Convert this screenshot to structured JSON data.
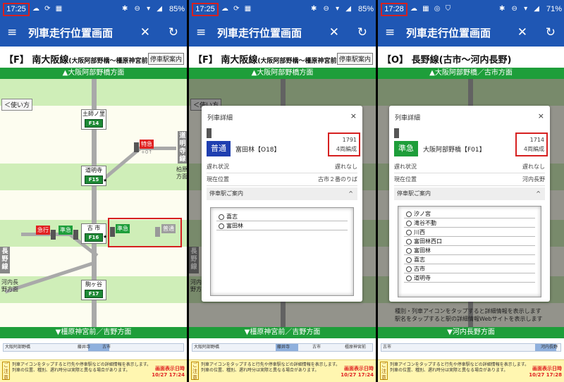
{
  "screens": [
    {
      "status": {
        "time": "17:25",
        "notif": "☁ ⟳ ▦",
        "sys": "✱ ⊖ ▾ ◢",
        "battery": "85%"
      },
      "app": {
        "menu": "≡",
        "title": "列車走行位置画面",
        "close": "✕",
        "refresh": "↻"
      },
      "line": {
        "name": "【F】 南大阪線",
        "sub": "(大阪阿部野橋〜橿原神宮前)",
        "stop_button": "停車駅案内"
      },
      "dir_top": "▲大阪阿部野橋方面",
      "dir_bottom": "▼橿原神宮前／吉野方面",
      "use_guide": "＜使い方",
      "stations": [
        {
          "name": "土師ノ里",
          "code": "F14",
          "star": ""
        },
        {
          "name": "道明寺",
          "code": "F15",
          "star": "★"
        },
        {
          "name": "古 市",
          "code": "F16",
          "star": "★"
        },
        {
          "name": "駒ヶ谷",
          "code": "F17",
          "star": ""
        }
      ],
      "trains": {
        "express_top": "特急",
        "express_delay": "+0↑",
        "express_left": "急行",
        "rapid_left": "準急",
        "rapid_right": "準急",
        "local_right": "普通"
      },
      "branch_right": {
        "name": "道明寺線",
        "dest": "柏原方面"
      },
      "branch_left": {
        "name": "長野線",
        "dest": "河内長野方面"
      },
      "minimap": {
        "left": "大阪阿部野橋",
        "mid1": "藤井寺",
        "mid2": "古市",
        "right": ""
      },
      "notice": {
        "icon": "ご注意",
        "line1": "列車アイコンをタップすると行先や停車駅などの詳細情報を表示します。",
        "line2": "列車の位置、種別、遅れ時分は実際と異なる場合があります。",
        "when_label": "画面表示日時",
        "when": "10/27 17:24"
      }
    },
    {
      "status": {
        "time": "17:25",
        "notif": "☁ ⟳ ▦",
        "sys": "✱ ⊖ ▾ ◢",
        "battery": "85%"
      },
      "app": {
        "menu": "≡",
        "title": "列車走行位置画面",
        "close": "✕",
        "refresh": "↻"
      },
      "line": {
        "name": "【F】 南大阪線",
        "sub": "(大阪阿部野橋〜橿原神宮前)",
        "stop_button": "停車駅案内"
      },
      "dir_top": "▲大阪阿部野橋方面",
      "dir_bottom": "▼橿原神宮前／吉野方面",
      "use_guide": "＜使い方",
      "side": {
        "name": "長野線",
        "dest": "河内長野方面"
      },
      "dialog": {
        "title": "列車詳細",
        "close": "×",
        "type": "普通",
        "type_color": "#1f3fb0",
        "station": "富田林【O18】",
        "number": "1791",
        "cars": "4両編成",
        "delay_label": "遅れ状況",
        "delay_value": "遅れなし",
        "pos_label": "現在位置",
        "pos_value": "古市２番のりば",
        "stops_label": "停車駅ご案内",
        "stops_caret": "^",
        "stops": [
          "喜志",
          "富田林"
        ]
      },
      "minimap": {
        "left": "大阪阿部野橋",
        "mid1": "藤井寺",
        "mid2": "古市",
        "right": "橿原神宮前"
      },
      "notice": {
        "icon": "ご注意",
        "line1": "列車アイコンをタップすると行先や停車駅などの詳細情報を表示します。",
        "line2": "列車の位置、種別、遅れ時分は実際と異なる場合があります。",
        "when_label": "画面表示日時",
        "when": "10/27 17:24"
      }
    },
    {
      "status": {
        "time": "17:28",
        "notif": "☁ ▦ ◎ ⛉",
        "sys": "✱ ⊖ ▾ ◢",
        "battery": "71%"
      },
      "app": {
        "menu": "≡",
        "title": "列車走行位置画面",
        "close": "✕",
        "refresh": "↻"
      },
      "line": {
        "name": "【O】 長野線",
        "sub": "(古市〜河内長野)",
        "stop_button": ""
      },
      "dir_top": "▲大阪阿部野橋／古市方面",
      "dir_bottom": "▼河内長野方面",
      "dialog": {
        "title": "列車詳細",
        "close": "×",
        "type": "準急",
        "type_color": "#1e9e3a",
        "station": "大阪阿部野橋【F01】",
        "number": "1714",
        "cars": "4両編成",
        "delay_label": "遅れ状況",
        "delay_value": "遅れなし",
        "pos_label": "現在位置",
        "pos_value": "河内長野",
        "stops_label": "停車駅ご案内",
        "stops_caret": "^",
        "stops": [
          "汐ノ宮",
          "滝谷不動",
          "川西",
          "富田林西口",
          "富田林",
          "喜志",
          "古市",
          "道明寺"
        ]
      },
      "hint": {
        "line1": "種別・列車アイコンをタップすると詳細情報を表示します",
        "line2": "駅名をタップすると駅の詳細情報Webサイトを表示します"
      },
      "minimap": {
        "left": "古市",
        "mid1": "",
        "mid2": "",
        "right": "河内長野"
      },
      "notice": {
        "icon": "ご注意",
        "line1": "列車アイコンをタップすると行先や停車駅などの詳細情報を表示します。",
        "line2": "列車の位置、種別、遅れ時分は実際と異なる場合があります。",
        "when_label": "画面表示日時",
        "when": "10/27 17:28"
      }
    }
  ]
}
